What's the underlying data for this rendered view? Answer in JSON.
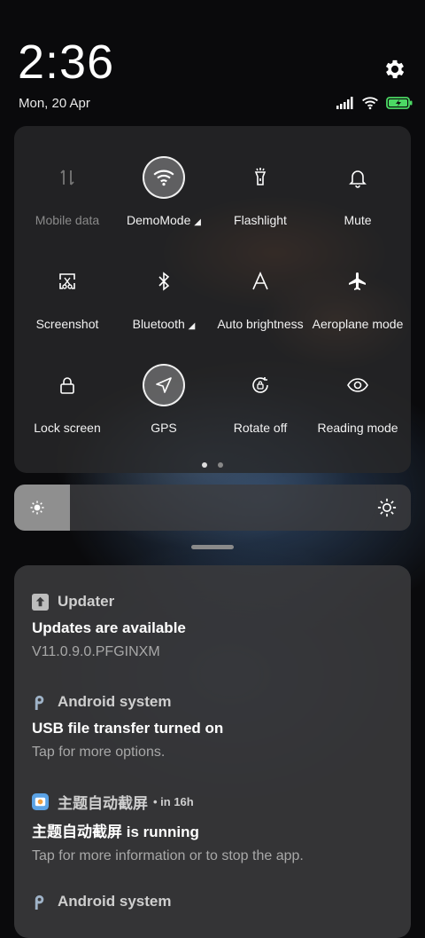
{
  "status_bar": {
    "time": "2:36",
    "date": "Mon, 20 Apr",
    "icons": [
      "signal-icon",
      "wifi-icon",
      "battery-charging-icon"
    ]
  },
  "quick_settings": {
    "tiles": [
      {
        "label": "Mobile data",
        "icon": "mobile-data-icon",
        "active": false,
        "disabled": true
      },
      {
        "label": "DemoMode",
        "icon": "wifi-icon",
        "active": true,
        "has_expand": true
      },
      {
        "label": "Flashlight",
        "icon": "flashlight-icon",
        "active": false
      },
      {
        "label": "Mute",
        "icon": "bell-icon",
        "active": false
      },
      {
        "label": "Screenshot",
        "icon": "screenshot-icon",
        "active": false
      },
      {
        "label": "Bluetooth",
        "icon": "bluetooth-icon",
        "active": false,
        "has_expand": true
      },
      {
        "label": "Auto brightness",
        "icon": "auto-brightness-icon",
        "active": false
      },
      {
        "label": "Aeroplane mode",
        "icon": "aeroplane-icon",
        "active": false
      },
      {
        "label": "Lock screen",
        "icon": "lock-icon",
        "active": false
      },
      {
        "label": "GPS",
        "icon": "gps-icon",
        "active": true
      },
      {
        "label": "Rotate off",
        "icon": "rotate-lock-icon",
        "active": false
      },
      {
        "label": "Reading mode",
        "icon": "eye-icon",
        "active": false
      }
    ],
    "page_count": 2,
    "current_page": 1
  },
  "brightness": {
    "level": 0.14
  },
  "notifications": [
    {
      "app": "Updater",
      "icon": "updater-icon",
      "time": "",
      "title": "Updates are available",
      "text": "V11.0.9.0.PFGINXM"
    },
    {
      "app": "Android system",
      "icon": "android-system-icon",
      "time": "",
      "title": "USB file transfer turned on",
      "text": "Tap for more options."
    },
    {
      "app": "主题自动截屏",
      "icon": "theme-app-icon",
      "time": "• in 16h",
      "title": "主题自动截屏 is running",
      "text": "Tap for more information or to stop the app."
    },
    {
      "app": "Android system",
      "icon": "android-system-icon",
      "time": "",
      "title": "",
      "text": ""
    }
  ],
  "colors": {
    "battery": "#4cd964",
    "tile_active_bg": "#ffffff"
  }
}
